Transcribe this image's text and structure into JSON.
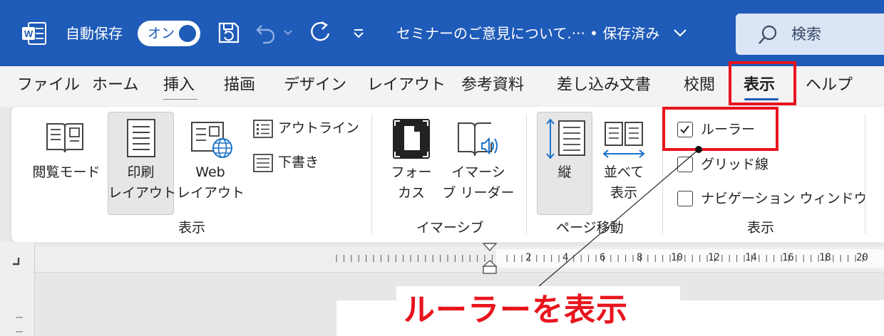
{
  "titlebar": {
    "autosave_label": "自動保存",
    "toggle_label": "オン",
    "document_title": "セミナーのご意見について.··· • 保存済み",
    "search_label": "検索"
  },
  "tabs": [
    {
      "label": "ファイル"
    },
    {
      "label": "ホーム"
    },
    {
      "label": "挿入"
    },
    {
      "label": "描画"
    },
    {
      "label": "デザイン"
    },
    {
      "label": "レイアウト"
    },
    {
      "label": "参考資料"
    },
    {
      "label": "差し込み文書"
    },
    {
      "label": "校閲"
    },
    {
      "label": "表示",
      "active": true
    },
    {
      "label": "ヘルプ"
    }
  ],
  "ribbon": {
    "views": {
      "read_mode": "閲覧モード",
      "print_layout_1": "印刷",
      "print_layout_2": "レイアウト",
      "web_layout_1": "Web",
      "web_layout_2": "レイアウト",
      "outline": "アウトライン",
      "draft": "下書き",
      "group_name": "表示"
    },
    "immersive": {
      "focus_1": "フォー",
      "focus_2": "カス",
      "reader_1": "イマーシ",
      "reader_2": "ブ リーダー",
      "group_name": "イマーシブ"
    },
    "page_movement": {
      "vertical": "縦",
      "side_by_side_1": "並べて",
      "side_by_side_2": "表示",
      "group_name": "ページ移動"
    },
    "show": {
      "ruler": "ルーラー",
      "ruler_checked": true,
      "gridlines": "グリッド線",
      "gridlines_checked": false,
      "navigation_pane": "ナビゲーション ウィンドウ",
      "navigation_checked": false,
      "group_name": "表示"
    }
  },
  "ruler": {
    "numbers": [
      "2",
      "4",
      "6",
      "8",
      "10",
      "12",
      "14",
      "16",
      "18",
      "20"
    ]
  },
  "annotation": {
    "callout": "ルーラーを表示",
    "highlight_color": "#e8141e"
  },
  "colors": {
    "titlebar_bg": "#1f5bb8",
    "accent": "#1f5bb8"
  }
}
